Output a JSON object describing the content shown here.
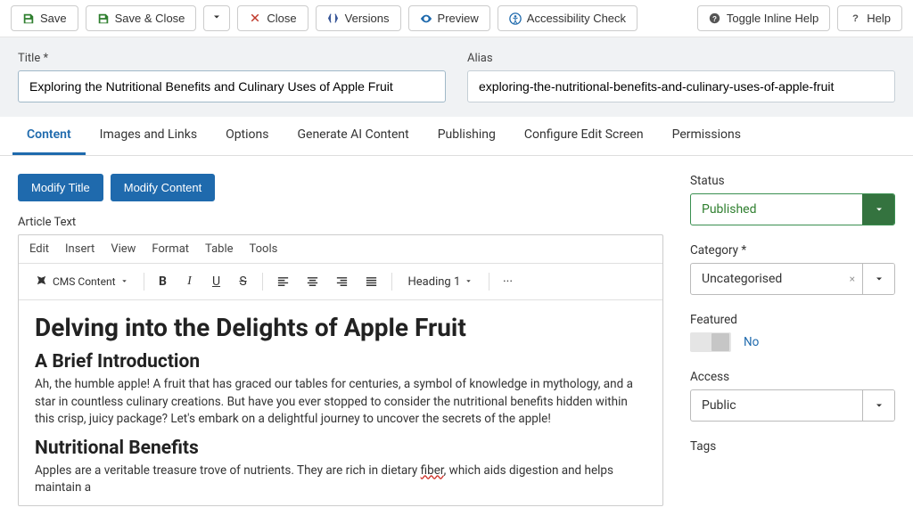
{
  "toolbar": {
    "save": "Save",
    "save_close": "Save & Close",
    "close": "Close",
    "versions": "Versions",
    "preview": "Preview",
    "accessibility": "Accessibility Check",
    "toggle_help": "Toggle Inline Help",
    "help": "Help"
  },
  "title": {
    "label": "Title *",
    "value": "Exploring the Nutritional Benefits and Culinary Uses of Apple Fruit"
  },
  "alias": {
    "label": "Alias",
    "value": "exploring-the-nutritional-benefits-and-culinary-uses-of-apple-fruit"
  },
  "tabs": {
    "content": "Content",
    "images": "Images and Links",
    "options": "Options",
    "ai": "Generate AI Content",
    "publishing": "Publishing",
    "configure": "Configure Edit Screen",
    "permissions": "Permissions"
  },
  "buttons": {
    "modify_title": "Modify Title",
    "modify_content": "Modify Content"
  },
  "article_label": "Article Text",
  "editor_menu": {
    "edit": "Edit",
    "insert": "Insert",
    "view": "View",
    "format": "Format",
    "table": "Table",
    "tools": "Tools"
  },
  "editor_toolbar": {
    "cms": "CMS Content",
    "heading": "Heading 1"
  },
  "article": {
    "h1": "Delving into the Delights of Apple Fruit",
    "h2a": "A Brief Introduction",
    "p1": "Ah, the humble apple! A fruit that has graced our tables for centuries, a symbol of knowledge in mythology, and a star in countless culinary creations. But have you ever stopped to consider the nutritional benefits hidden within this crisp, juicy package? Let's embark on a delightful journey to uncover the secrets of the apple!",
    "h2b": "Nutritional Benefits",
    "p2a": "Apples are a veritable treasure trove of nutrients. They are rich in dietary ",
    "p2_fiber": "fiber",
    "p2b": ", which aids digestion and helps maintain a"
  },
  "sidebar": {
    "status": {
      "label": "Status",
      "value": "Published"
    },
    "category": {
      "label": "Category *",
      "value": "Uncategorised"
    },
    "featured": {
      "label": "Featured",
      "value": "No"
    },
    "access": {
      "label": "Access",
      "value": "Public"
    },
    "tags": {
      "label": "Tags"
    }
  }
}
